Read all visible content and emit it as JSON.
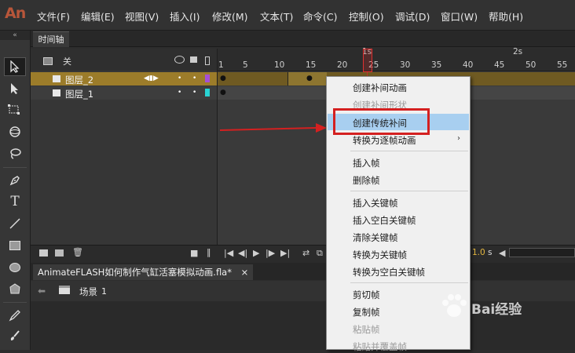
{
  "app": {
    "logo": "An"
  },
  "menu": [
    "文件(F)",
    "编辑(E)",
    "视图(V)",
    "插入(I)",
    "修改(M)",
    "文本(T)",
    "命令(C)",
    "控制(O)",
    "调试(D)",
    "窗口(W)",
    "帮助(H)"
  ],
  "timeline": {
    "tab_label": "时间轴",
    "header_label": "关",
    "layers": [
      {
        "name": "图层_2",
        "selected": true,
        "color": "#a64fd6"
      },
      {
        "name": "图层_1",
        "selected": false,
        "color": "#29d3d3"
      }
    ],
    "ruler_ticks": [
      "1",
      "5",
      "10",
      "15",
      "20",
      "25",
      "30",
      "35",
      "40",
      "45",
      "50",
      "55"
    ],
    "seconds": [
      "1s",
      "2s"
    ],
    "fps_value": "1.0",
    "fps_unit": "s"
  },
  "document": {
    "tab_label": "AnimateFLASH如何制作气缸活塞模拟动画.fla*",
    "close": "×",
    "scene_label": "场景",
    "scene_number": "1"
  },
  "context_menu": {
    "items": [
      {
        "label": "创建补间动画",
        "disabled": false
      },
      {
        "label": "创建补间形状",
        "disabled": true
      },
      {
        "label": "创建传统补间",
        "disabled": false,
        "highlighted": true
      },
      {
        "label": "转换为逐帧动画",
        "disabled": false,
        "submenu": true
      },
      {
        "label": "插入帧",
        "disabled": false
      },
      {
        "label": "删除帧",
        "disabled": false
      },
      {
        "label": "插入关键帧",
        "disabled": false
      },
      {
        "label": "插入空白关键帧",
        "disabled": false
      },
      {
        "label": "清除关键帧",
        "disabled": false
      },
      {
        "label": "转换为关键帧",
        "disabled": false
      },
      {
        "label": "转换为空白关键帧",
        "disabled": false
      },
      {
        "label": "剪切帧",
        "disabled": false
      },
      {
        "label": "复制帧",
        "disabled": false
      },
      {
        "label": "粘贴帧",
        "disabled": true
      },
      {
        "label": "粘贴并覆盖帧",
        "disabled": true
      }
    ],
    "submenu_arrow": "›"
  },
  "watermark": {
    "text": "Bai经验"
  },
  "colors": {
    "accent": "#d42020",
    "selection": "#a8cff0",
    "layer_highlight": "#9c7c2a"
  }
}
